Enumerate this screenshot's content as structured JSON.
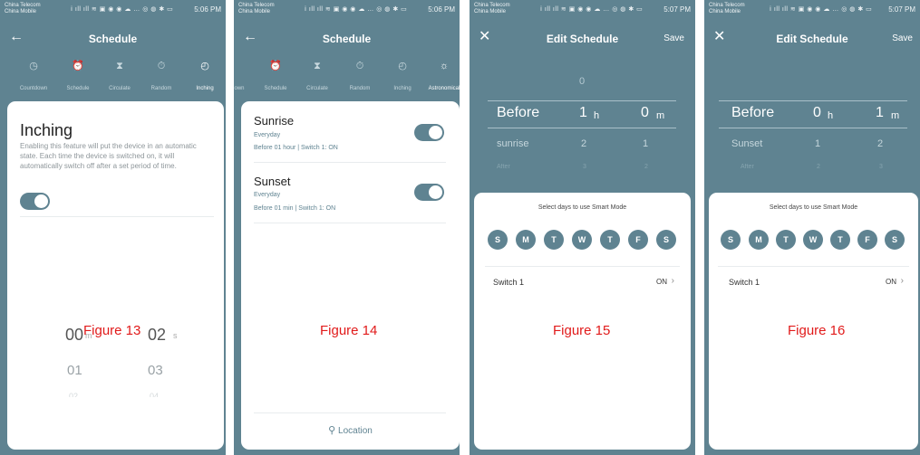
{
  "status_bar": {
    "carrier_1": "China Telecom",
    "carrier_2": "China Mobile",
    "icons": "ⅰ ıll ıll ≋ ▣ ◉ ◉ ☁ … ◎ ◍ ✱ ▭",
    "times": [
      "5:06 PM",
      "5:06 PM",
      "5:07 PM",
      "5:07 PM"
    ]
  },
  "figures": [
    "Figure 13",
    "Figure 14",
    "Figure 15",
    "Figure 16"
  ],
  "screen1": {
    "title": "Schedule",
    "tabs": [
      {
        "label": "Countdown",
        "icon": "clock-icon"
      },
      {
        "label": "Schedule",
        "icon": "alarm-icon"
      },
      {
        "label": "Circulate",
        "icon": "hourglass-icon"
      },
      {
        "label": "Random",
        "icon": "stopwatch-icon"
      },
      {
        "label": "Inching",
        "icon": "timer-icon"
      }
    ],
    "active_tab": "Inching",
    "heading": "Inching",
    "description": "Enabling this feature will put the device in an automatic state. Each time the device is switched on, it will automatically switch off after a set period of time.",
    "toggle_on": true,
    "picker": {
      "selected_minutes": "00",
      "selected_seconds": "02",
      "minutes_unit": "m",
      "seconds_unit": "s",
      "next_minutes": "01",
      "next_seconds": "03",
      "faded_minutes": "02",
      "faded_seconds": "04"
    }
  },
  "screen2": {
    "title": "Schedule",
    "tabs": [
      {
        "label": "own",
        "icon": ""
      },
      {
        "label": "Schedule",
        "icon": "alarm-icon"
      },
      {
        "label": "Circulate",
        "icon": "hourglass-icon"
      },
      {
        "label": "Random",
        "icon": "stopwatch-icon"
      },
      {
        "label": "Inching",
        "icon": "timer-icon"
      },
      {
        "label": "Astronomical",
        "icon": "sun-icon"
      }
    ],
    "active_tab": "Astronomical",
    "items": [
      {
        "title": "Sunrise",
        "repeat": "Everyday",
        "detail": "Before 01 hour | Switch 1: ON",
        "enabled": true
      },
      {
        "title": "Sunset",
        "repeat": "Everyday",
        "detail": "Before 01 min | Switch 1: ON",
        "enabled": true
      }
    ],
    "location_label": "Location"
  },
  "screen3": {
    "title": "Edit Schedule",
    "save_label": "Save",
    "picker": {
      "above": [
        "",
        "0",
        ""
      ],
      "selected": [
        "Before",
        "1",
        "0"
      ],
      "below": [
        "sunrise",
        "2",
        "1"
      ],
      "faded": [
        "After",
        "3",
        "2"
      ],
      "units": [
        "h",
        "m"
      ]
    },
    "days_prompt": "Select days to use Smart Mode",
    "days": [
      "S",
      "M",
      "T",
      "W",
      "T",
      "F",
      "S"
    ],
    "switch_label": "Switch 1",
    "switch_value": "ON"
  },
  "screen4": {
    "title": "Edit Schedule",
    "save_label": "Save",
    "picker": {
      "selected": [
        "Before",
        "0",
        "1"
      ],
      "below": [
        "Sunset",
        "1",
        "2"
      ],
      "faded": [
        "After",
        "2",
        "3"
      ],
      "units": [
        "h",
        "m"
      ]
    },
    "days_prompt": "Select days to use Smart Mode",
    "days": [
      "S",
      "M",
      "T",
      "W",
      "T",
      "F",
      "S"
    ],
    "switch_label": "Switch 1",
    "switch_value": "ON"
  },
  "colors": {
    "accent": "#5f8391",
    "figure_label": "#e11a1a",
    "card": "#ffffff"
  }
}
